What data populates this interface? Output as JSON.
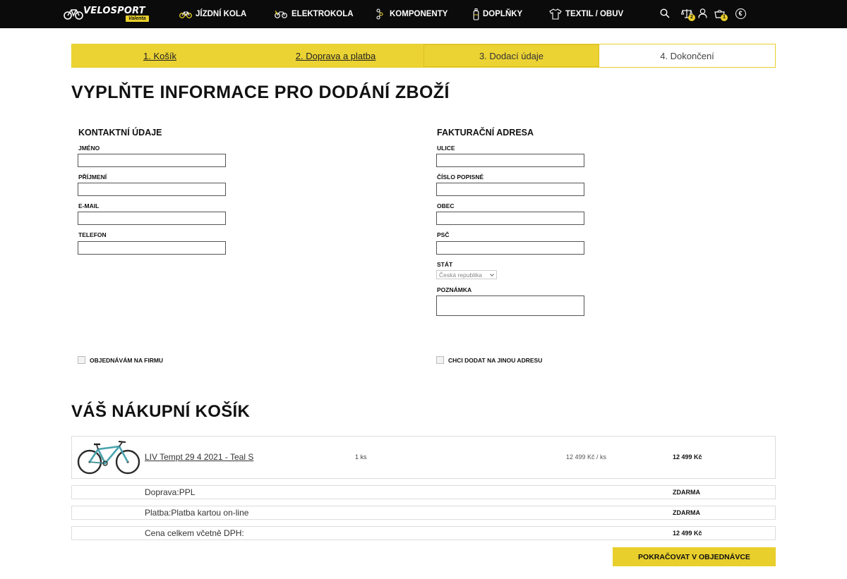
{
  "brand": {
    "name": "VELOSPORT",
    "tagline": "Valenta"
  },
  "nav": {
    "items": [
      {
        "label": "Jízdní kola",
        "icon": "bicycle-icon"
      },
      {
        "label": "Elektrokola",
        "icon": "ebike-icon"
      },
      {
        "label": "Komponenty",
        "icon": "chain-icon"
      },
      {
        "label": "Doplňky",
        "icon": "bottle-icon"
      },
      {
        "label": "Textil / obuv",
        "icon": "tshirt-icon"
      }
    ],
    "compare_count": "2",
    "cart_count": "1",
    "currency_symbol": "€"
  },
  "steps": [
    {
      "label": "1. Košík",
      "state": "done"
    },
    {
      "label": "2. Doprava a platba",
      "state": "done"
    },
    {
      "label": "3. Dodací údaje",
      "state": "current"
    },
    {
      "label": "4. Dokončení",
      "state": "next"
    }
  ],
  "page_title": "Vyplňte informace pro dodání zboží",
  "contact": {
    "title": "Kontaktní údaje",
    "first_name_label": "Jméno",
    "last_name_label": "Příjmení",
    "email_label": "E-mail",
    "phone_label": "Telefon"
  },
  "billing": {
    "title": "Fakturační adresa",
    "street_label": "Ulice",
    "house_number_label": "Číslo popisné",
    "city_label": "Obec",
    "zip_label": "PSČ",
    "country_label": "Stát",
    "country_value": "Česká republika",
    "note_label": "Poznámka"
  },
  "checkboxes": {
    "company": "Objednávám na firmu",
    "other_address": "Chci dodat na jinou adresu"
  },
  "cart": {
    "title": "Váš nákupní košík",
    "product": {
      "name": "LIV Tempt 29 4 2021 - Teal S",
      "qty": "1 ks",
      "unit_price": "12 499 Kč / ks",
      "total": "12 499 Kč"
    },
    "shipping": {
      "label": "Doprava:PPL",
      "value": "ZDARMA"
    },
    "payment": {
      "label": "Platba:Platba kartou on-line",
      "value": "ZDARMA"
    },
    "grand_total": {
      "label": "Cena celkem včetně DPH:",
      "value": "12 499 Kč"
    }
  },
  "continue_label": "Pokračovat v objednávce",
  "colors": {
    "accent": "#e8cf2c",
    "topbar": "#0b0b0b"
  }
}
